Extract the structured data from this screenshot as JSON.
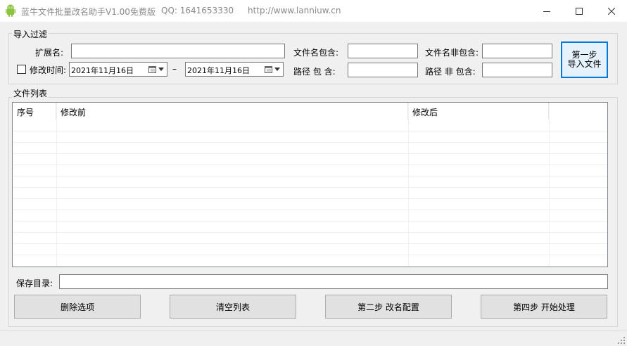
{
  "window": {
    "title": "蓝牛文件批量改名助手V1.00免费版",
    "qq": "QQ:  1641653330",
    "url": "http://www.lanniuw.cn",
    "icon": "android-icon"
  },
  "filter": {
    "group_label": "导入过滤",
    "ext_label": "扩展名:",
    "ext_value": "",
    "name_contains_label": "文件名包含:",
    "name_contains_value": "",
    "name_excludes_label": "文件名非包含:",
    "name_excludes_value": "",
    "modified_label": "修改时间:",
    "modified_checked": false,
    "date_from": "2021年11月16日",
    "date_sep": "–",
    "date_to": "2021年11月16日",
    "path_contains_label": "路径 包 含:",
    "path_contains_value": "",
    "path_excludes_label": "路径 非 包含:",
    "path_excludes_value": "",
    "import_button_line1": "第一步",
    "import_button_line2": "导入文件"
  },
  "file_list": {
    "group_label": "文件列表",
    "columns": [
      "序号",
      "修改前",
      "修改后",
      ""
    ],
    "rows": []
  },
  "save": {
    "label": "保存目录:",
    "value": ""
  },
  "actions": {
    "delete": "删除选项",
    "clear": "清空列表",
    "step2": "第二步  改名配置",
    "step4": "第四步  开始处理"
  }
}
